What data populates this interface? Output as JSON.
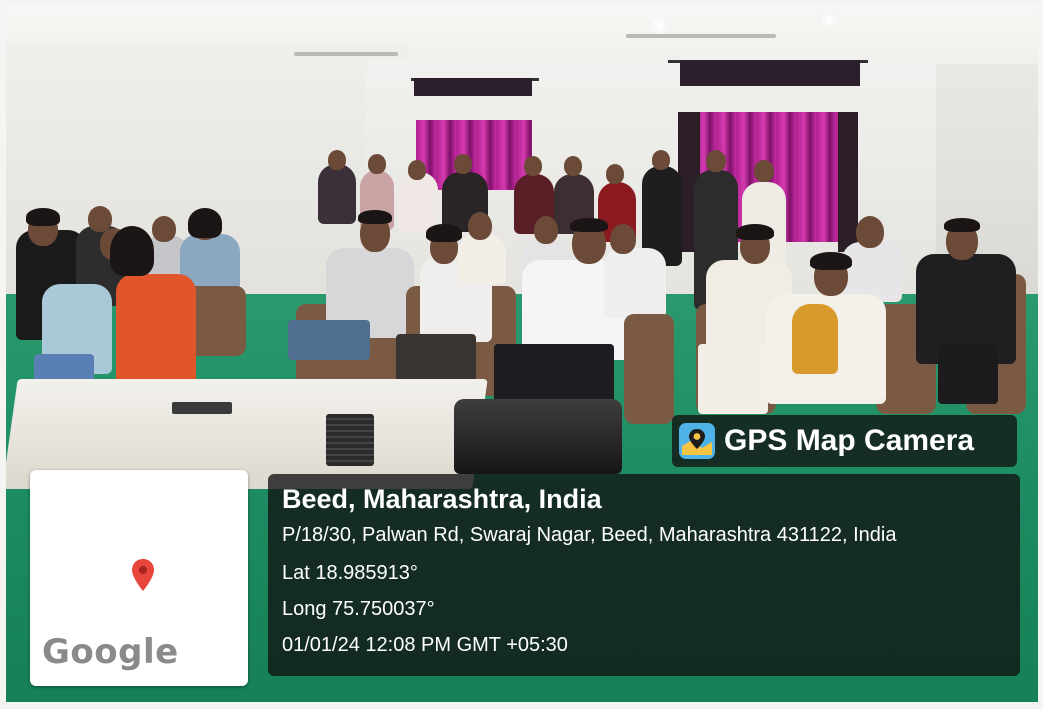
{
  "overlay": {
    "app_name": "GPS Map Camera",
    "location_title": "Beed, Maharashtra, India",
    "address": "P/18/30, Palwan Rd, Swaraj Nagar, Beed, Maharashtra 431122, India",
    "latitude": "Lat 18.985913°",
    "longitude": "Long 75.750037°",
    "timestamp": "01/01/24 12:08 PM GMT +05:30"
  },
  "map": {
    "provider_logo": "Google",
    "pin_icon": "map-pin-icon",
    "pin_color": "#e8453c"
  },
  "badge": {
    "icon": "gps-map-camera-icon",
    "icon_colors": [
      "#4fb3e8",
      "#f6c342"
    ]
  },
  "photo": {
    "wall_color": "#ecebe7",
    "floor_color": "#1d8b61",
    "curtain_color": "#c52aa3"
  }
}
